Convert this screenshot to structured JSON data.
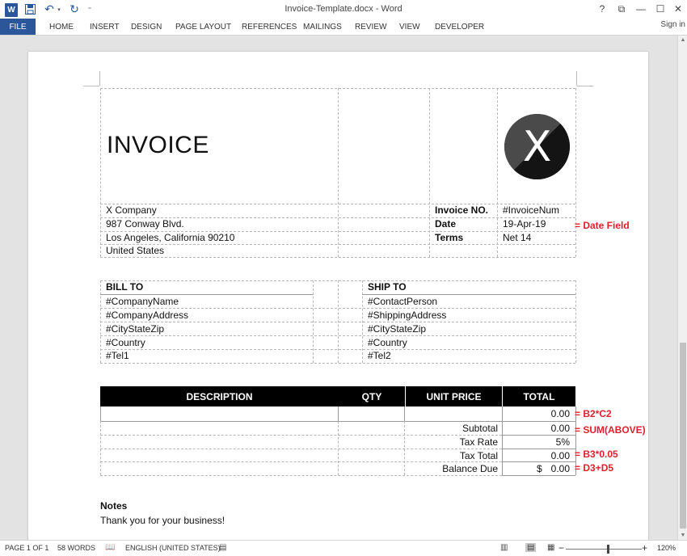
{
  "window": {
    "title": "Invoice-Template.docx - Word",
    "help": "?",
    "restore_ribbon": "⧉",
    "minimize": "—",
    "maximize": "☐",
    "close": "✕"
  },
  "quick_access": {
    "app_icon": "W",
    "save": "💾",
    "undo": "↶",
    "undo_drop": "▾",
    "redo": "↻",
    "customize": "⁼"
  },
  "ribbon": {
    "tabs": [
      "FILE",
      "HOME",
      "INSERT",
      "DESIGN",
      "PAGE LAYOUT",
      "REFERENCES",
      "MAILINGS",
      "REVIEW",
      "VIEW",
      "DEVELOPER"
    ],
    "sign_in": "Sign in"
  },
  "document": {
    "invoice_title": "INVOICE",
    "logo_letter": "X",
    "company": {
      "name": "X Company",
      "street": "987 Conway Blvd.",
      "city": "Los Angeles, California 90210",
      "country": "United States"
    },
    "meta": {
      "invoice_no_label": "Invoice NO.",
      "invoice_no_value": "#InvoiceNum",
      "date_label": "Date",
      "date_value": "19-Apr-19",
      "terms_label": "Terms",
      "terms_value": "Net 14"
    },
    "bill_to": {
      "header": "BILL TO",
      "lines": [
        "#CompanyName",
        "#CompanyAddress",
        "#CityStateZip",
        "#Country",
        "#Tel1"
      ]
    },
    "ship_to": {
      "header": "SHIP TO",
      "lines": [
        "#ContactPerson",
        "#ShippingAddress",
        "#CityStateZip",
        "#Country",
        "#Tel2"
      ]
    },
    "items_table": {
      "headers": [
        "DESCRIPTION",
        "QTY",
        "UNIT PRICE",
        "TOTAL"
      ],
      "line_total": "0.00",
      "subtotal_label": "Subtotal",
      "subtotal_value": "0.00",
      "tax_rate_label": "Tax Rate",
      "tax_rate_value": "5%",
      "tax_total_label": "Tax Total",
      "tax_total_value": "0.00",
      "balance_label": "Balance Due",
      "balance_currency": "$",
      "balance_value": "0.00"
    },
    "notes": {
      "title": "Notes",
      "text": "Thank you for your business!"
    },
    "annotations": {
      "date_field": "= Date Field",
      "line_total": "= B2*C2",
      "subtotal": "= SUM(ABOVE)",
      "tax_total": "= B3*0.05",
      "balance": "= D3+D5"
    }
  },
  "status_bar": {
    "page": "PAGE 1 OF 1",
    "words": "58 WORDS",
    "language": "ENGLISH (UNITED STATES)",
    "zoom_minus": "−",
    "zoom_plus": "+",
    "zoom_level": "120%"
  },
  "colors": {
    "word_blue": "#2b579a",
    "annotation_red": "#e0202e",
    "table_header_bg": "#000000"
  }
}
